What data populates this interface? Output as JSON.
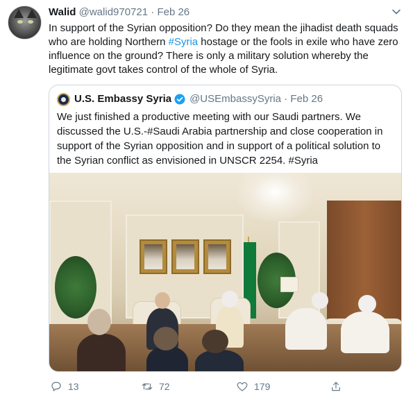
{
  "tweet": {
    "name": "Walid",
    "handle": "@walid970721",
    "separator": "·",
    "date": "Feb 26",
    "text_parts": [
      "In support of the Syrian opposition? Do they mean the jihadist death squads who are holding Northern ",
      "#Syria",
      " hostage or the fools in exile who have zero influence on the ground? There is only a military solution whereby the legitimate govt takes control of the whole of Syria."
    ],
    "avatar_icon": "cat-avatar",
    "caret_icon": "chevron-down-icon"
  },
  "quote": {
    "name": "U.S. Embassy Syria",
    "handle": "@USEmbassySyria",
    "separator": "·",
    "date": "Feb 26",
    "text": "We just finished a productive meeting with our Saudi partners.  We discussed the U.S.-#Saudi Arabia partnership and close cooperation in support of the Syrian opposition and in support of a political solution to the Syrian conflict as envisioned in UNSCR 2254. #Syria",
    "verified_icon": "verified-badge-icon",
    "avatar_icon": "embassy-seal-icon",
    "photo_description_icon": "meeting-photo"
  },
  "actions": {
    "reply_count": "13",
    "retweet_count": "72",
    "like_count": "179",
    "reply_icon": "reply-icon",
    "retweet_icon": "retweet-icon",
    "like_icon": "heart-icon",
    "share_icon": "share-icon"
  },
  "colors": {
    "link": "#1b95e0",
    "muted": "#657786",
    "verified": "#1da1f2",
    "border": "#ccd6dd"
  }
}
